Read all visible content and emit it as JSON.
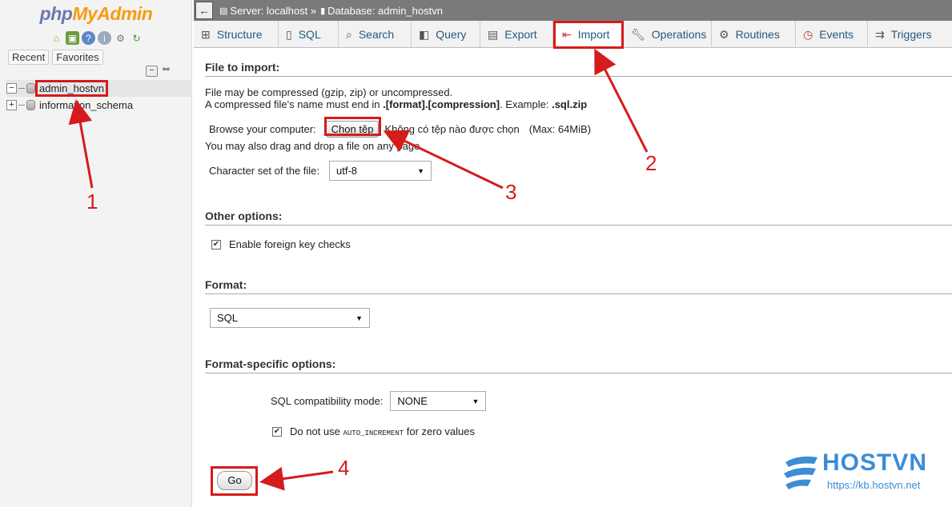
{
  "app": {
    "logo_php": "php",
    "logo_myadmin": "MyAdmin"
  },
  "nav": {
    "tabs": [
      "Recent",
      "Favorites"
    ],
    "icons": [
      "home-icon",
      "logout-icon",
      "help-icon",
      "docs-icon",
      "settings-icon",
      "reload-icon"
    ],
    "tree": [
      {
        "label": "admin_hostvn",
        "expander": "−",
        "selected": true
      },
      {
        "label": "information_schema",
        "expander": "+",
        "selected": false
      }
    ]
  },
  "breadcrumb": {
    "server": "Server: localhost »",
    "database": "Database: admin_hostvn"
  },
  "tabs": [
    {
      "label": "Structure",
      "icon": "structure-icon",
      "active": false
    },
    {
      "label": "SQL",
      "icon": "sql-icon",
      "active": false
    },
    {
      "label": "Search",
      "icon": "search-icon",
      "active": false
    },
    {
      "label": "Query",
      "icon": "query-icon",
      "active": false
    },
    {
      "label": "Export",
      "icon": "export-icon",
      "active": false
    },
    {
      "label": "Import",
      "icon": "import-icon",
      "active": true
    },
    {
      "label": "Operations",
      "icon": "wrench-icon",
      "active": false
    },
    {
      "label": "Routines",
      "icon": "routines-icon",
      "active": false
    },
    {
      "label": "Events",
      "icon": "clock-icon",
      "active": false
    },
    {
      "label": "Triggers",
      "icon": "triggers-icon",
      "active": false
    }
  ],
  "import": {
    "title": "File to import:",
    "line1": "File may be compressed (gzip, zip) or uncompressed.",
    "line2_prefix": "A compressed file's name must end in ",
    "line2_bold": ".[format].[compression]",
    "line2_mid": ". Example: ",
    "line2_example": ".sql.zip",
    "browse_label": "Browse your computer:",
    "choose_button": "Chọn tệp",
    "no_file": "Không có tệp nào được chọn",
    "max": "(Max: 64MiB)",
    "drag_drop": "You may also drag and drop a file on any page.",
    "charset_label": "Character set of the file:",
    "charset_value": "utf-8"
  },
  "other": {
    "title": "Other options:",
    "fk_label": "Enable foreign key checks",
    "fk_checked": true
  },
  "format": {
    "title": "Format:",
    "value": "SQL"
  },
  "format_specific": {
    "title": "Format-specific options:",
    "compat_label": "SQL compatibility mode:",
    "compat_value": "NONE",
    "auto_inc_prefix": "Do not use ",
    "auto_inc_code": "AUTO_INCREMENT",
    "auto_inc_suffix": " for zero values",
    "auto_inc_checked": true
  },
  "go_button": "Go",
  "annotations": [
    "1",
    "2",
    "3",
    "4"
  ],
  "brand": {
    "name": "HOSTVN",
    "url": "https://kb.hostvn.net"
  },
  "colors": {
    "highlight": "#d51b1b",
    "link": "#235a81",
    "brand": "#3b8dd6"
  }
}
